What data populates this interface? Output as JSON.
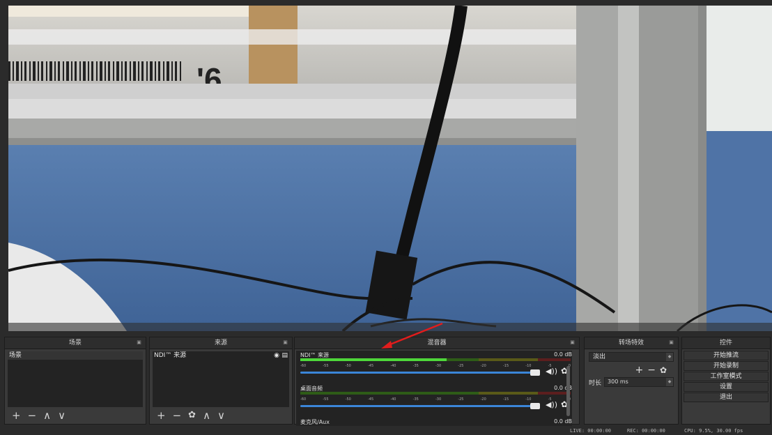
{
  "docks": {
    "scenes": {
      "title": "场景",
      "items": [
        "场景"
      ]
    },
    "sources": {
      "title": "来源",
      "items": [
        "NDI™ 来源"
      ]
    },
    "mixer": {
      "title": "混音器",
      "channels": [
        {
          "name": "NDI™ 来源",
          "db": "0.0 dB",
          "level": 0.54
        },
        {
          "name": "桌面音频",
          "db": "0.0 dB",
          "level": 0.0
        },
        {
          "name": "麦克风/Aux",
          "db": "0.0 dB",
          "level": 0.0
        }
      ],
      "scale": [
        "-60",
        "-55",
        "-50",
        "-45",
        "-40",
        "-35",
        "-30",
        "-25",
        "-20",
        "-15",
        "-10",
        "-5",
        "0"
      ]
    },
    "transitions": {
      "title": "转场特效",
      "selected": "淡出",
      "duration_label": "时长",
      "duration_value": "300 ms"
    },
    "controls": {
      "title": "控件",
      "buttons": [
        "开始推流",
        "开始录制",
        "工作室模式",
        "设置",
        "退出"
      ]
    }
  },
  "status": {
    "live": "LIVE: 00:00:00",
    "rec": "REC: 00:00:00",
    "cpu": "CPU: 9.5%, 30.00 fps"
  },
  "preview": {
    "label": "'6"
  },
  "icons": {
    "plus": "+",
    "minus": "−",
    "up": "∧",
    "down": "∨",
    "gear": "✿",
    "eye": "👁",
    "lock": "🔒",
    "speaker": "🔊"
  },
  "colors": {
    "accent": "#3b86d8",
    "meter_green": "#4ed83a",
    "annotation_red": "#e21c1c"
  }
}
